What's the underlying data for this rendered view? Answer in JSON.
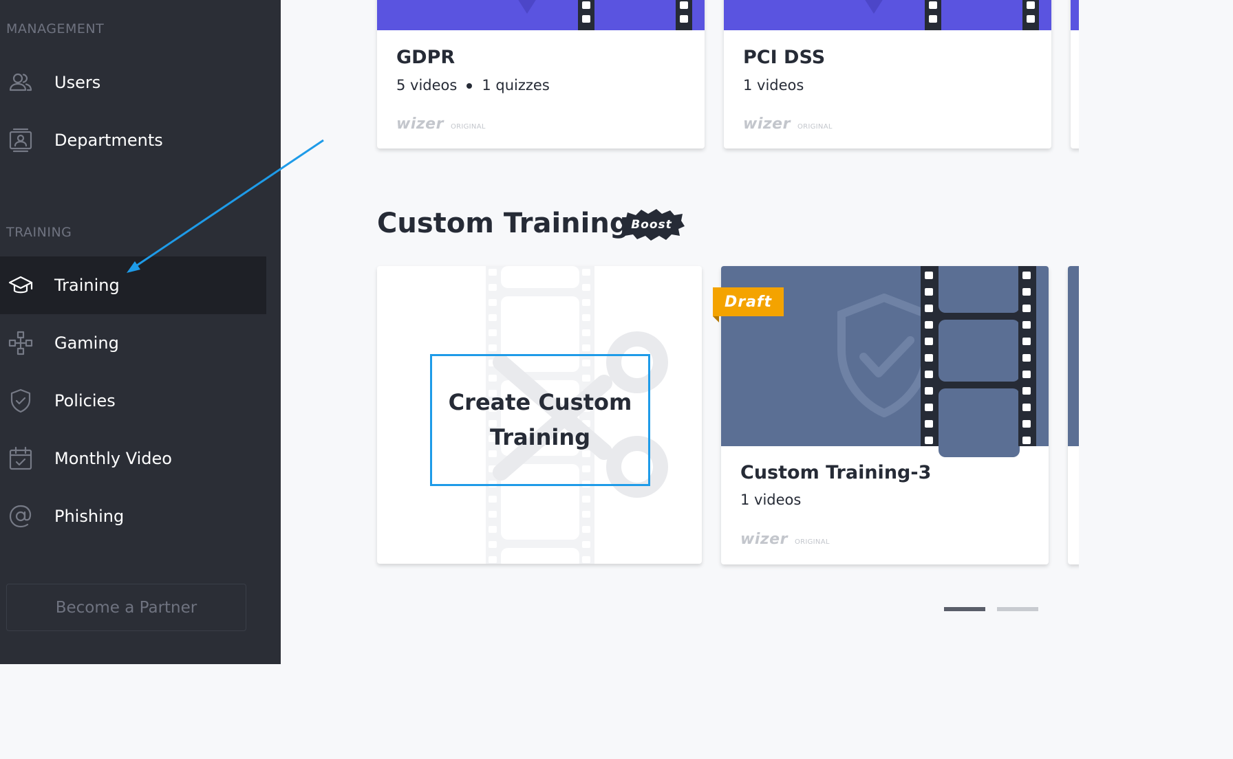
{
  "sidebar": {
    "management_label": "MANAGEMENT",
    "training_label": "TRAINING",
    "items": [
      {
        "label": "Users",
        "icon": "users-icon"
      },
      {
        "label": "Departments",
        "icon": "departments-icon"
      },
      {
        "label": "Training",
        "icon": "graduation-cap-icon",
        "active": true
      },
      {
        "label": "Gaming",
        "icon": "gamepad-icon"
      },
      {
        "label": "Policies",
        "icon": "shield-check-icon"
      },
      {
        "label": "Monthly Video",
        "icon": "calendar-check-icon"
      },
      {
        "label": "Phishing",
        "icon": "at-sign-icon"
      }
    ],
    "partner_button": "Become a Partner"
  },
  "library": {
    "cards": [
      {
        "title": "GDPR",
        "videos": "5 videos",
        "quizzes": "1 quizzes",
        "brand": "wizer",
        "badge": "ORIGINAL"
      },
      {
        "title": "PCI DSS",
        "videos": "1 videos",
        "brand": "wizer",
        "badge": "ORIGINAL"
      }
    ]
  },
  "custom_training": {
    "heading": "Custom Training",
    "boost_badge": "Boost",
    "create_card_label": "Create Custom Training",
    "cards": [
      {
        "title": "Custom Training-3",
        "videos": "1 videos",
        "status": "Draft",
        "brand": "wizer",
        "badge": "ORIGINAL"
      }
    ],
    "pager": {
      "pages": 2,
      "current": 1
    }
  },
  "colors": {
    "sidebar_bg": "#2b2e36",
    "active_item_bg": "#1e2026",
    "banner_purple": "#5a54e0",
    "thumbnail_slate": "#5b6f94",
    "draft_orange": "#f4a300",
    "annotation_blue": "#1e9be8"
  }
}
